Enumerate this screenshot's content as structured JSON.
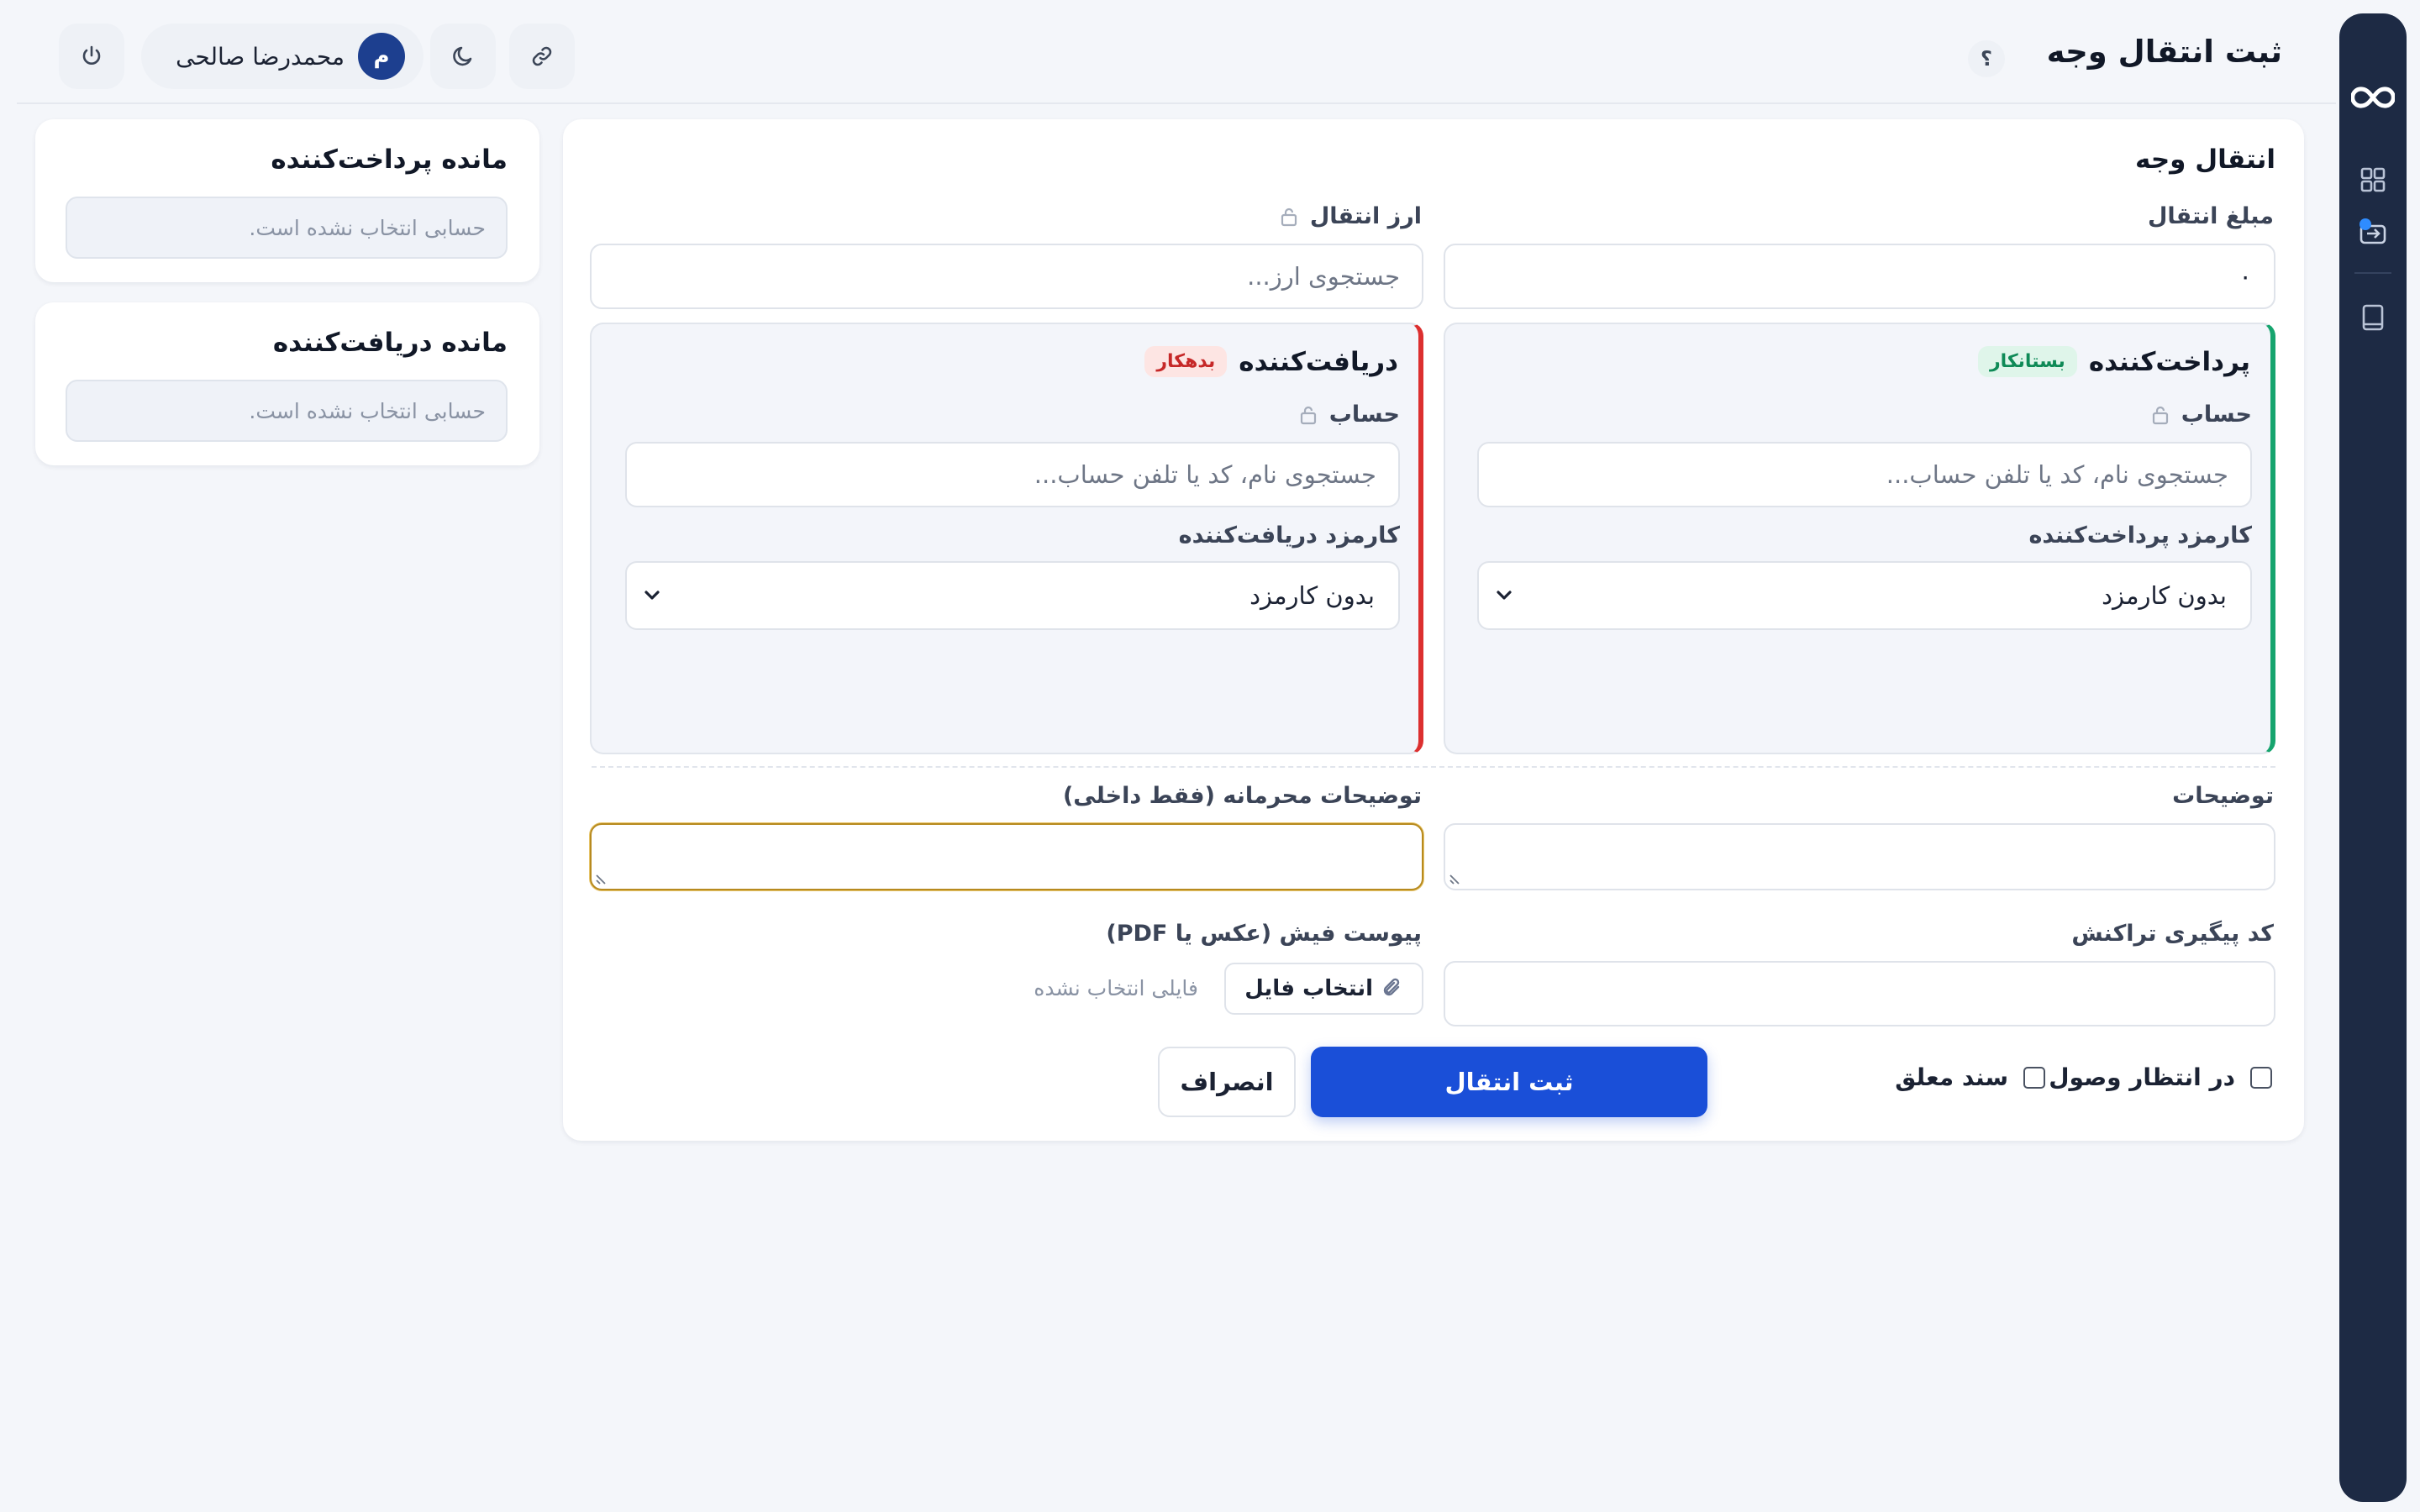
{
  "header": {
    "title": "ثبت انتقال وجه",
    "help": "؟",
    "user_name": "محمدرضا صالحی",
    "user_initial": "م"
  },
  "icons": {
    "rail": [
      "infinity-logo-icon",
      "grid-icon",
      "transfer-icon",
      "book-icon"
    ],
    "topbar": [
      "power-icon",
      "moon-icon",
      "link-icon"
    ],
    "misc": [
      "lock-icon",
      "chevron-down-icon",
      "paperclip-icon"
    ]
  },
  "colors": {
    "rail_bg": "#1d2a44",
    "accent": "#1a4fd8",
    "payer": "#16a46e",
    "receiver": "#dc2f2f",
    "focus": "#b78a1f"
  },
  "transfer": {
    "title": "انتقال وجه",
    "amount_label": "مبلغ انتقال",
    "amount_value": "۰",
    "currency_label": "ارز انتقال",
    "currency_placeholder": "جستجوی ارز...",
    "payer": {
      "title": "پرداخت‌کننده",
      "badge": "بستانکار",
      "account_label": "حساب",
      "account_placeholder": "جستجوی نام، کد یا تلفن حساب...",
      "fee_label": "کارمزد پرداخت‌کننده",
      "fee_value": "بدون کارمزد"
    },
    "receiver": {
      "title": "دریافت‌کننده",
      "badge": "بدهکار",
      "account_label": "حساب",
      "account_placeholder": "جستجوی نام، کد یا تلفن حساب...",
      "fee_label": "کارمزد دریافت‌کننده",
      "fee_value": "بدون کارمزد"
    },
    "description_label": "توضیحات",
    "private_notes_label": "توضیحات محرمانه (فقط داخلی)",
    "tracking_label": "کد پیگیری تراکنش",
    "attachment_label": "پیوست فیش (عکس یا PDF)",
    "choose_file": "انتخاب فایل",
    "no_file": "فایلی انتخاب نشده",
    "pending_label": "در انتظار وصول",
    "suspended_label": "سند معلق",
    "submit": "ثبت انتقال",
    "cancel": "انصراف"
  },
  "balances": {
    "payer_title": "مانده پرداخت‌کننده",
    "payer_empty": "حسابی انتخاب نشده است.",
    "receiver_title": "مانده دریافت‌کننده",
    "receiver_empty": "حسابی انتخاب نشده است."
  }
}
